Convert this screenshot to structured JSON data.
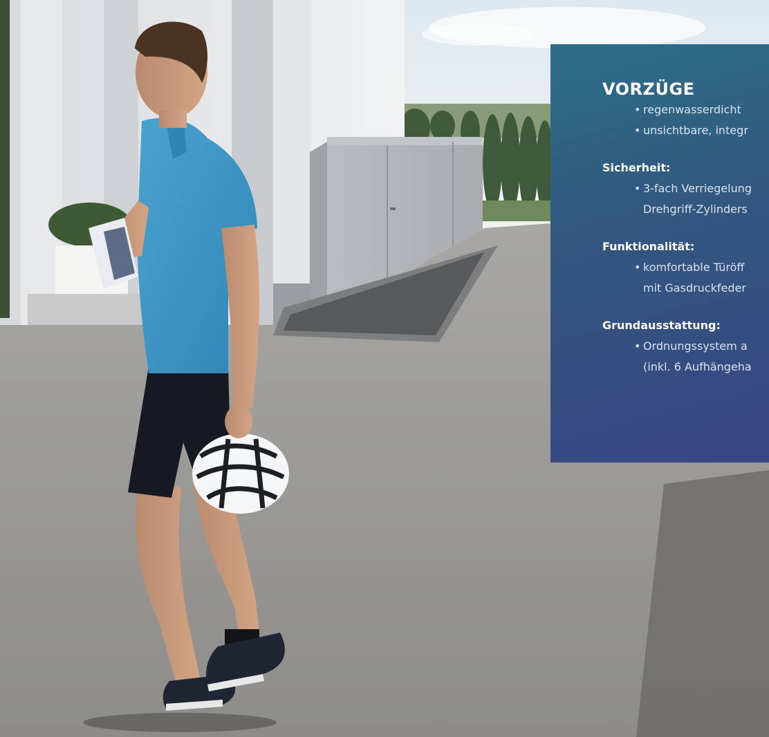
{
  "photo": {
    "subject": "man-with-bike-helmet",
    "object": "metal-garden-storage-box"
  },
  "panel": {
    "title": "VORZÜGE",
    "intro_items": [
      "regenwasserdicht",
      "unsichtbare, integr"
    ],
    "sections": [
      {
        "heading": "Sicherheit:",
        "items": [
          "3-fach Verriegelung",
          "Drehgriff-Zylinders"
        ]
      },
      {
        "heading": "Funktionalität:",
        "items": [
          "komfortable Türöff",
          "mit Gasdruckfeder"
        ]
      },
      {
        "heading": "Grundausstattung:",
        "items": [
          "Ordnungssystem a",
          "(inkl. 6 Aufhängeha"
        ]
      }
    ],
    "colors": {
      "gradient_top": "#2d6e86",
      "gradient_bottom": "#384683",
      "text": "#ffffff",
      "muted_text": "#d9e3ee"
    }
  }
}
